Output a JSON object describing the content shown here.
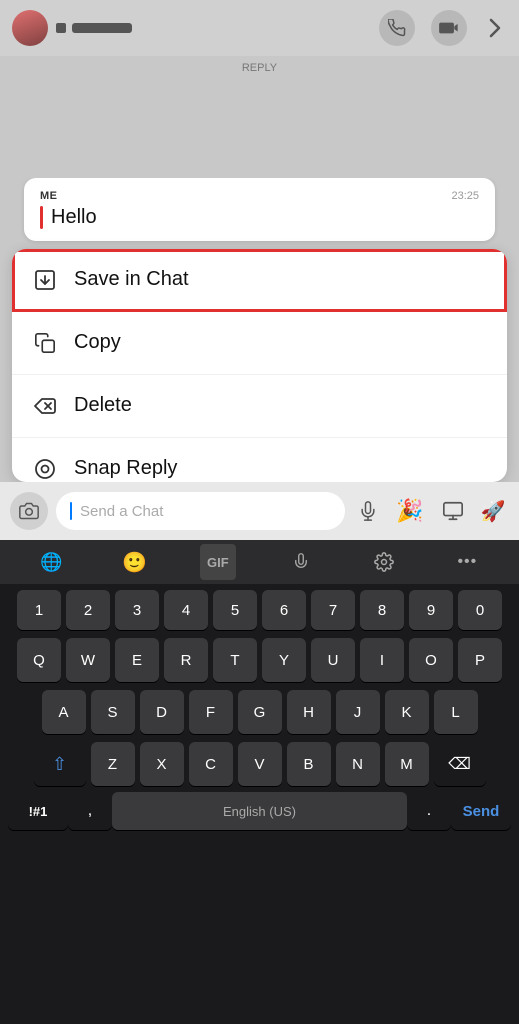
{
  "header": {
    "username_placeholder": "■ ████",
    "time_label": "23:25",
    "phone_icon": "phone",
    "video_icon": "video",
    "more_icon": "chevron-right"
  },
  "message": {
    "sender": "ME",
    "time": "23:25",
    "text": "Hello"
  },
  "context_menu": {
    "items": [
      {
        "id": "save-in-chat",
        "label": "Save in Chat",
        "icon": "download",
        "highlighted": true
      },
      {
        "id": "copy",
        "label": "Copy",
        "icon": "copy",
        "highlighted": false
      },
      {
        "id": "delete",
        "label": "Delete",
        "icon": "eraser",
        "highlighted": false
      },
      {
        "id": "snap-reply",
        "label": "Snap Reply",
        "icon": "camera-circle",
        "highlighted": false
      }
    ]
  },
  "input_bar": {
    "placeholder": "Send a Chat",
    "mic_label": "mic",
    "camera_label": "camera"
  },
  "keyboard": {
    "toolbar_items": [
      "emoji-alt",
      "smiley",
      "gif",
      "mic",
      "settings",
      "more"
    ],
    "num_row": [
      "1",
      "2",
      "3",
      "4",
      "5",
      "6",
      "7",
      "8",
      "9",
      "0"
    ],
    "row1": [
      "Q",
      "W",
      "E",
      "R",
      "T",
      "Y",
      "U",
      "I",
      "O",
      "P"
    ],
    "row2": [
      "A",
      "S",
      "D",
      "F",
      "G",
      "H",
      "J",
      "K",
      "L"
    ],
    "row3": [
      "Z",
      "X",
      "C",
      "V",
      "B",
      "N",
      "M"
    ],
    "shift_label": "⇧",
    "backspace_label": "⌫",
    "sym_label": "!#1",
    "comma_label": ",",
    "space_label": "English (US)",
    "period_label": ".",
    "send_label": "Send",
    "language": "English (US)"
  }
}
